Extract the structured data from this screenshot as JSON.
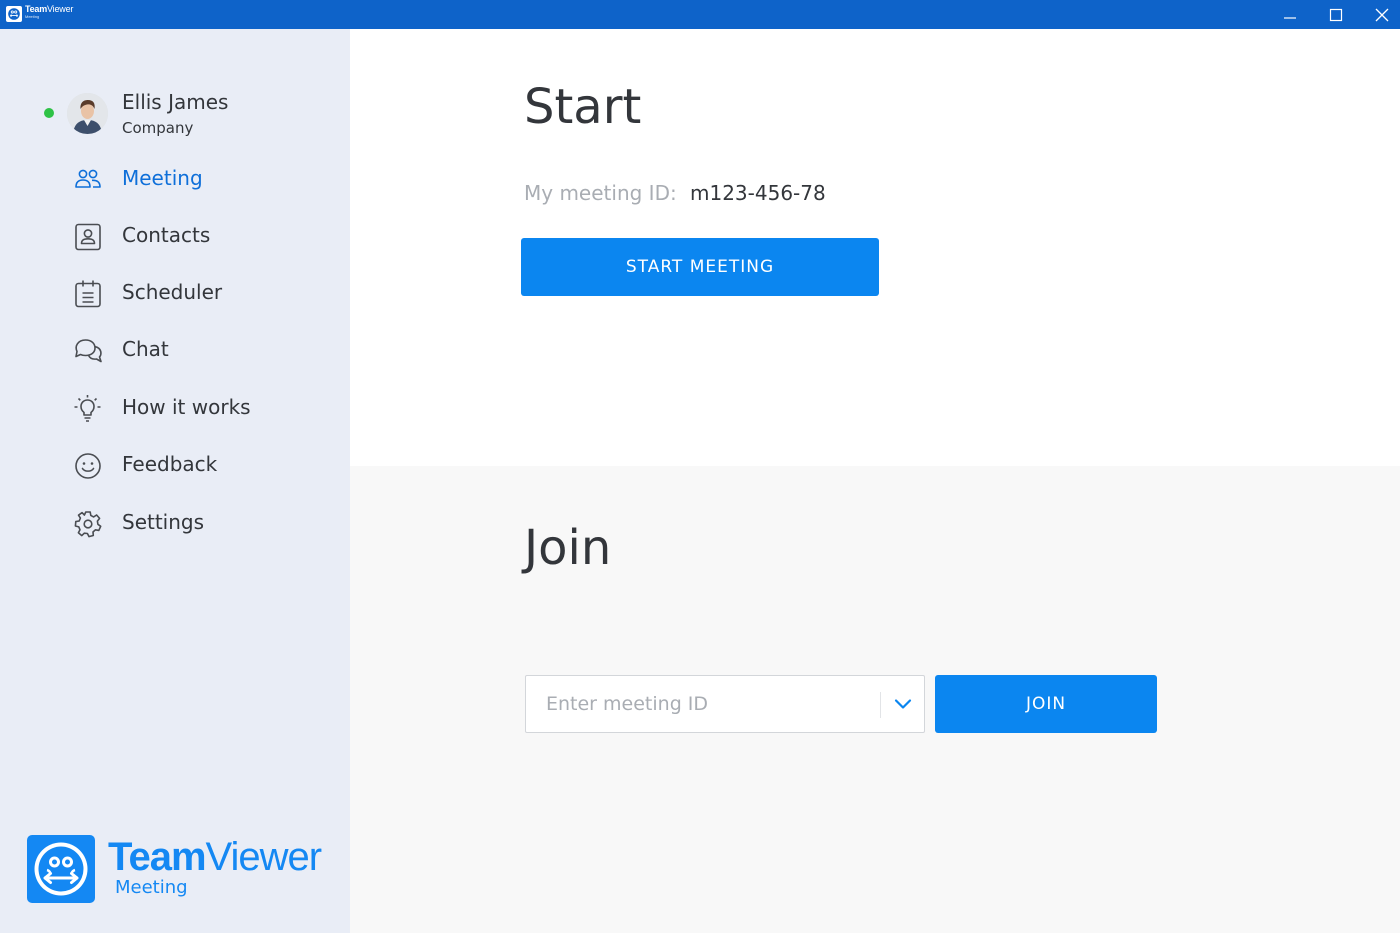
{
  "window": {
    "brand_team": "Team",
    "brand_viewer": "Viewer",
    "brand_sub": "Meeting"
  },
  "user": {
    "name": "Ellis James",
    "company": "Company",
    "status": "online"
  },
  "sidebar": {
    "items": [
      {
        "label": "Meeting",
        "icon": "people-icon",
        "active": true
      },
      {
        "label": "Contacts",
        "icon": "contact-card-icon"
      },
      {
        "label": "Scheduler",
        "icon": "calendar-icon"
      },
      {
        "label": "Chat",
        "icon": "chat-bubbles-icon"
      },
      {
        "label": "How it works",
        "icon": "lightbulb-icon"
      },
      {
        "label": "Feedback",
        "icon": "smiley-icon"
      },
      {
        "label": "Settings",
        "icon": "gear-icon"
      }
    ],
    "brand_team": "Team",
    "brand_viewer": "Viewer",
    "brand_sub": "Meeting"
  },
  "start": {
    "title": "Start",
    "meeting_id_label": "My meeting ID:",
    "meeting_id_value": "m123-456-78",
    "button_label": "START MEETING"
  },
  "join": {
    "title": "Join",
    "input_placeholder": "Enter meeting ID",
    "button_label": "JOIN"
  },
  "colors": {
    "titlebar": "#0e63c9",
    "accent": "#0b86f0",
    "active_nav": "#0e6fd9",
    "status_online": "#2ec246",
    "sidebar_bg": "#e9edf6"
  }
}
